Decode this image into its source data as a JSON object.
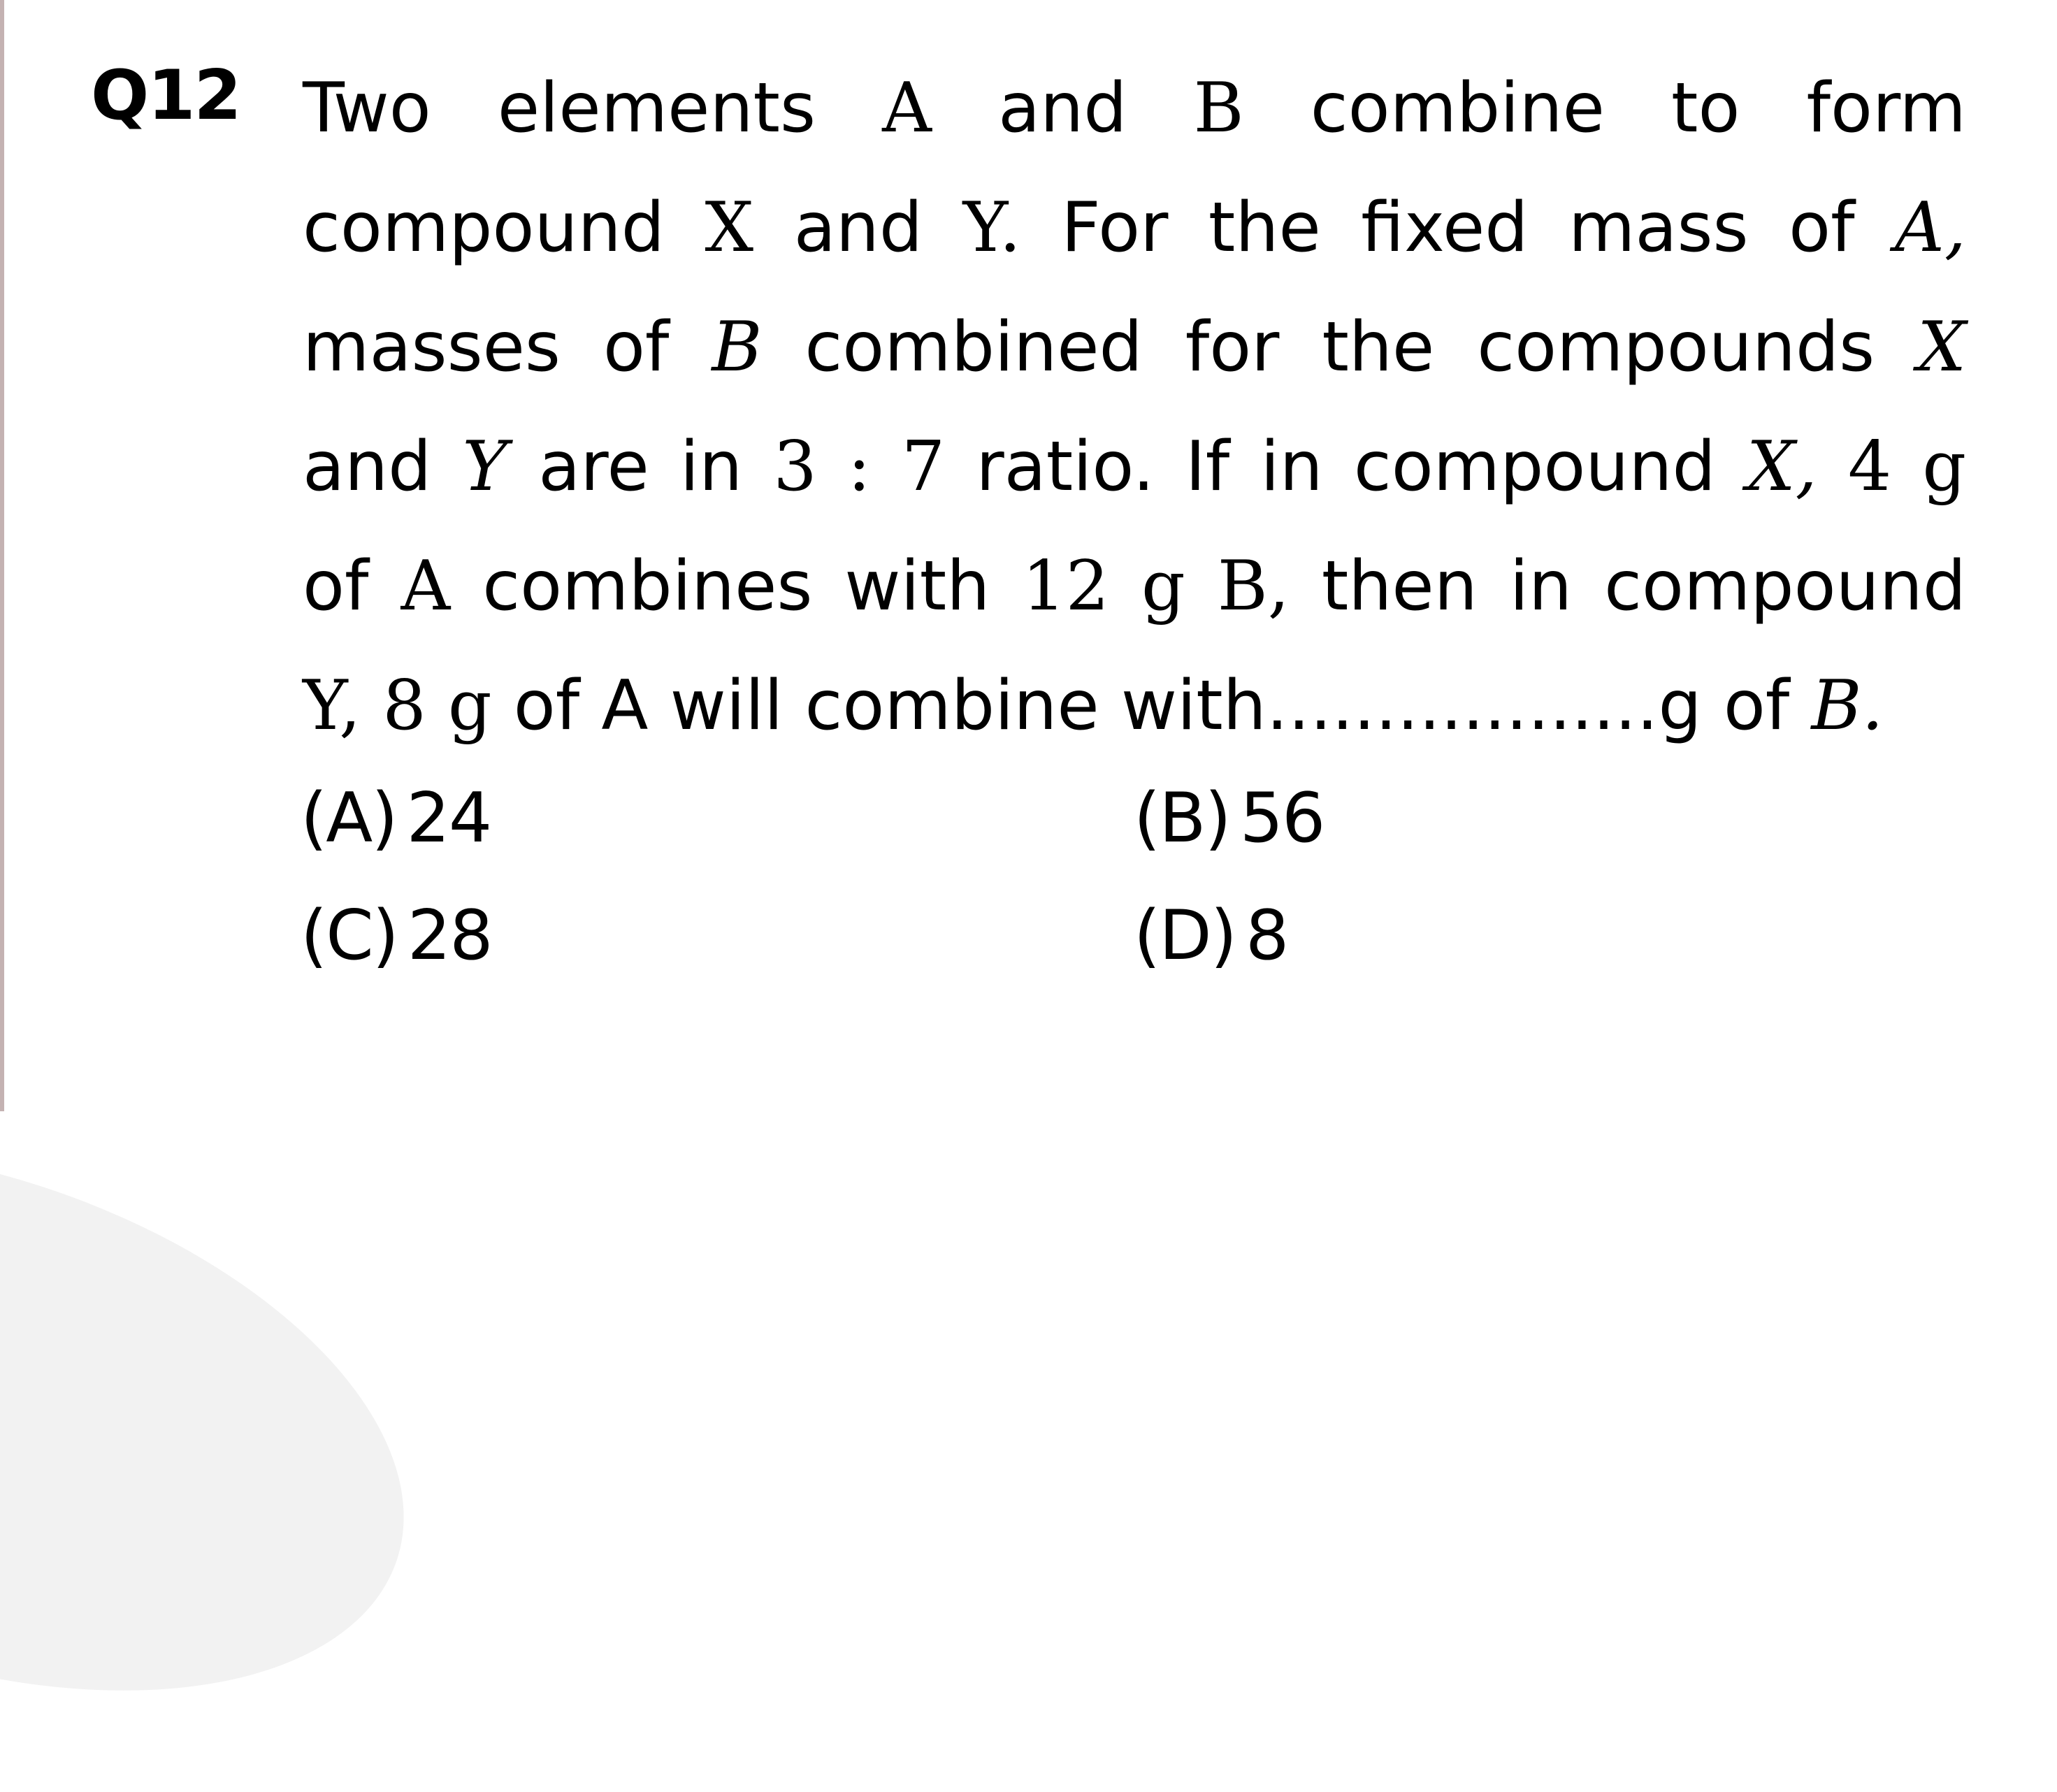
{
  "question": {
    "number": "Q12",
    "lines": [
      [
        {
          "t": "Two",
          "s": "text"
        },
        {
          "t": "elements",
          "s": "text"
        },
        {
          "t": "A",
          "s": "math"
        },
        {
          "t": "and",
          "s": "text"
        },
        {
          "t": "B",
          "s": "math"
        },
        {
          "t": "combine",
          "s": "text"
        },
        {
          "t": "to",
          "s": "text"
        },
        {
          "t": "form",
          "s": "text"
        }
      ],
      [
        {
          "t": "compound",
          "s": "text"
        },
        {
          "t": "X",
          "s": "math"
        },
        {
          "t": "and",
          "s": "text"
        },
        {
          "t": "Y.",
          "s": "math"
        },
        {
          "t": "For",
          "s": "text"
        },
        {
          "t": "the",
          "s": "text"
        },
        {
          "t": "fixed",
          "s": "text"
        },
        {
          "t": "mass",
          "s": "text"
        },
        {
          "t": "of",
          "s": "text"
        },
        {
          "t": "A,",
          "s": "mathi"
        }
      ],
      [
        {
          "t": "masses",
          "s": "text"
        },
        {
          "t": "of",
          "s": "text"
        },
        {
          "t": "B",
          "s": "mathi"
        },
        {
          "t": "combined",
          "s": "text"
        },
        {
          "t": "for",
          "s": "text"
        },
        {
          "t": "the",
          "s": "text"
        },
        {
          "t": "compounds",
          "s": "text"
        },
        {
          "t": "X",
          "s": "mathi"
        }
      ],
      [
        {
          "t": "and",
          "s": "text"
        },
        {
          "t": "Y",
          "s": "mathi"
        },
        {
          "t": "are",
          "s": "text"
        },
        {
          "t": "in",
          "s": "text"
        },
        {
          "t": "3 : 7",
          "s": "math"
        },
        {
          "t": "ratio.",
          "s": "text"
        },
        {
          "t": "If",
          "s": "text"
        },
        {
          "t": "in",
          "s": "text"
        },
        {
          "t": "compound",
          "s": "text"
        },
        {
          "t": "X,",
          "s": "mathi"
        },
        {
          "t": "4 g",
          "s": "math"
        }
      ],
      [
        {
          "t": "of",
          "s": "text"
        },
        {
          "t": "A",
          "s": "math"
        },
        {
          "t": "combines",
          "s": "text"
        },
        {
          "t": "with",
          "s": "text"
        },
        {
          "t": "12 g B,",
          "s": "math"
        },
        {
          "t": "then",
          "s": "text"
        },
        {
          "t": "in",
          "s": "text"
        },
        {
          "t": "compound",
          "s": "text"
        }
      ],
      [
        {
          "t": "Y, 8 g",
          "s": "math"
        },
        {
          "t": "of A will combine with..................g of",
          "s": "text"
        },
        {
          "t": "B.",
          "s": "mathi"
        }
      ]
    ],
    "full_text": "Two elements A and B combine to form compound X and Y. For the fixed mass of A, masses of B combined for the compounds X and Y are in 3 : 7 ratio. If in compound X, 4 g of A combines with 12 g B, then in compound Y, 8 g of A will combine with..................g of B."
  },
  "options": [
    {
      "label": "(A)",
      "value": "24"
    },
    {
      "label": "(B)",
      "value": "56"
    },
    {
      "label": "(C)",
      "value": "28"
    },
    {
      "label": "(D)",
      "value": "8"
    }
  ],
  "colors": {
    "left_rule": "#c4b2b2",
    "text": "#000000",
    "background": "#ffffff",
    "swoosh": "#f2f2f2"
  }
}
